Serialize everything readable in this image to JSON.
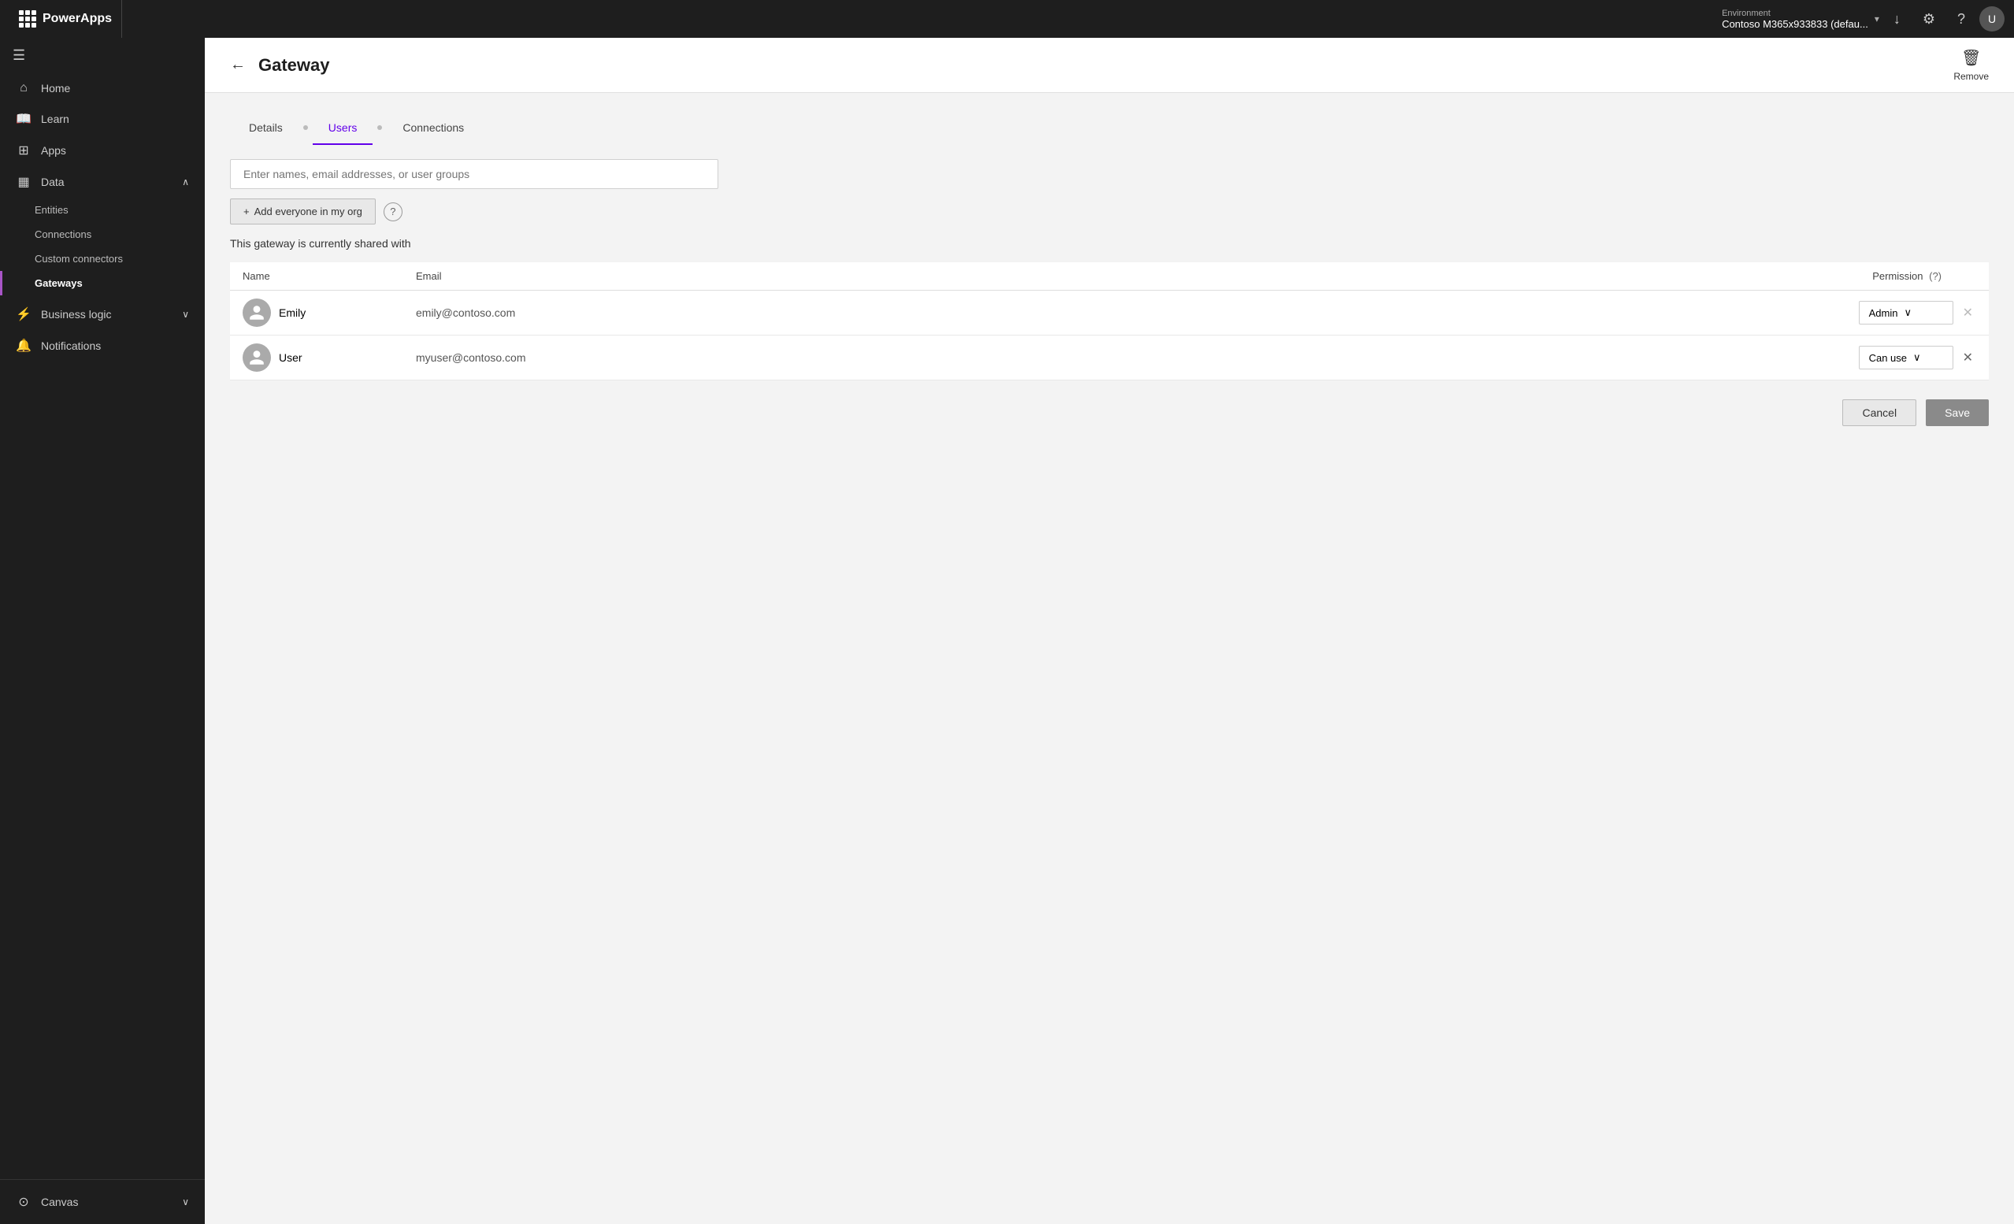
{
  "topbar": {
    "app_name": "PowerApps",
    "environment_label": "Environment",
    "environment_value": "Contoso M365x933833 (defau...",
    "download_icon": "↓",
    "settings_icon": "⚙",
    "help_icon": "?",
    "avatar_label": "U"
  },
  "sidebar": {
    "hamburger_icon": "☰",
    "items": [
      {
        "id": "home",
        "label": "Home",
        "icon": "⌂"
      },
      {
        "id": "learn",
        "label": "Learn",
        "icon": "📖"
      },
      {
        "id": "apps",
        "label": "Apps",
        "icon": "⊞"
      },
      {
        "id": "data",
        "label": "Data",
        "icon": "▦",
        "has_chevron": true,
        "expanded": true
      }
    ],
    "data_subitems": [
      {
        "id": "entities",
        "label": "Entities"
      },
      {
        "id": "connections",
        "label": "Connections"
      },
      {
        "id": "custom-connectors",
        "label": "Custom connectors"
      },
      {
        "id": "gateways",
        "label": "Gateways",
        "active": true
      }
    ],
    "bottom_items": [
      {
        "id": "business-logic",
        "label": "Business logic",
        "icon": "⚡",
        "has_chevron": true
      },
      {
        "id": "notifications",
        "label": "Notifications",
        "icon": "🔔"
      }
    ],
    "footer": {
      "id": "canvas",
      "label": "Canvas",
      "icon": "⊙",
      "has_chevron": true
    }
  },
  "page": {
    "back_icon": "←",
    "title": "Gateway",
    "remove_label": "Remove",
    "trash_icon": "🗑"
  },
  "tabs": [
    {
      "id": "details",
      "label": "Details",
      "active": false
    },
    {
      "id": "users",
      "label": "Users",
      "active": true
    },
    {
      "id": "connections",
      "label": "Connections",
      "active": false
    }
  ],
  "users_tab": {
    "search_placeholder": "Enter names, email addresses, or user groups",
    "add_everyone_label": "Add everyone in my org",
    "plus_icon": "+",
    "help_icon": "?",
    "shared_label": "This gateway is currently shared with",
    "table": {
      "col_name": "Name",
      "col_email": "Email",
      "col_permission": "Permission",
      "rows": [
        {
          "name": "Emily",
          "email": "emily@contoso.com",
          "permission": "Admin",
          "can_remove": false
        },
        {
          "name": "User",
          "email": "myuser@contoso.com",
          "permission": "Can use",
          "can_remove": true
        }
      ]
    },
    "cancel_label": "Cancel",
    "save_label": "Save"
  }
}
